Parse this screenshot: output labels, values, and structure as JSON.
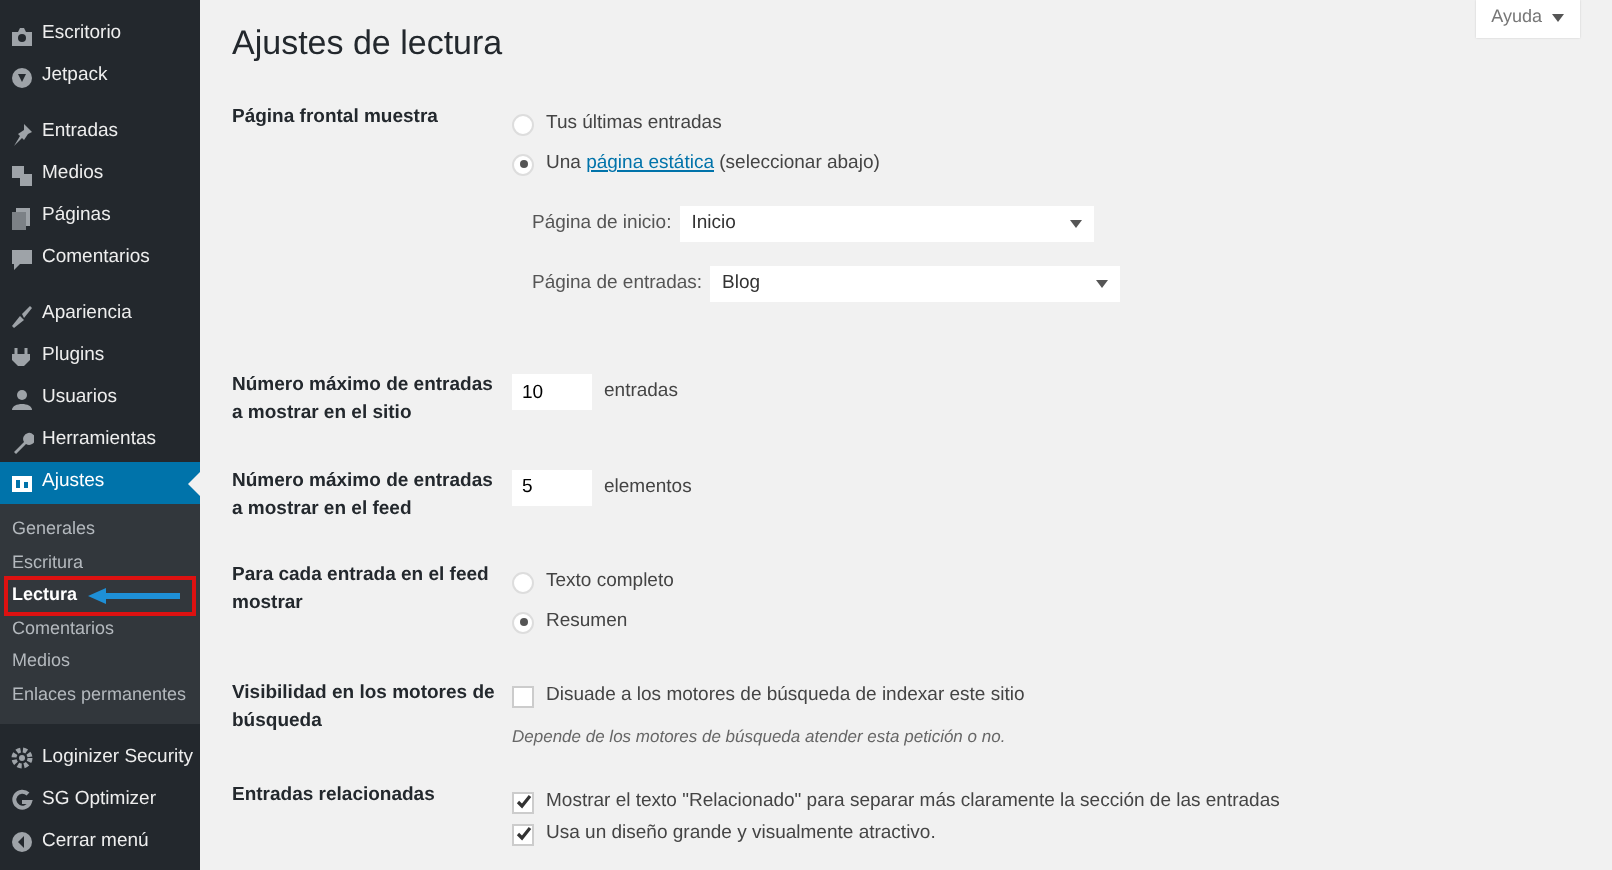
{
  "sidebar": {
    "groups": [
      [
        {
          "label": "Escritorio",
          "selected": false
        },
        {
          "label": "Jetpack",
          "selected": false
        }
      ],
      [
        {
          "label": "Entradas",
          "selected": false
        },
        {
          "label": "Medios",
          "selected": false
        },
        {
          "label": "Páginas",
          "selected": false
        },
        {
          "label": "Comentarios",
          "selected": false
        }
      ],
      [
        {
          "label": "Apariencia",
          "selected": false
        },
        {
          "label": "Plugins",
          "selected": false
        },
        {
          "label": "Usuarios",
          "selected": false
        },
        {
          "label": "Herramientas",
          "selected": false
        },
        {
          "label": "Ajustes",
          "selected": true,
          "submenu": [
            {
              "label": "Generales",
              "selected": false,
              "annotated": false
            },
            {
              "label": "Escritura",
              "selected": false,
              "annotated": false
            },
            {
              "label": "Lectura",
              "selected": true,
              "annotated": true
            },
            {
              "label": "Comentarios",
              "selected": false,
              "annotated": false
            },
            {
              "label": "Medios",
              "selected": false,
              "annotated": false
            },
            {
              "label": "Enlaces permanentes",
              "selected": false,
              "annotated": false
            }
          ]
        }
      ],
      [
        {
          "label": "Loginizer Security",
          "selected": false
        },
        {
          "label": "SG Optimizer",
          "selected": false
        },
        {
          "label": "Cerrar menú",
          "selected": false
        }
      ]
    ]
  },
  "help_button": {
    "label": "Ayuda"
  },
  "title": "Ajustes de lectura",
  "settings": [
    {
      "kind": "front",
      "label": "Página frontal muestra",
      "options": [
        {
          "label": "Tus últimas entradas",
          "selected": false
        },
        {
          "prefix": "Una",
          "link": "página estática",
          "suffix": "(seleccionar abajo)",
          "selected": true
        }
      ],
      "selects": [
        {
          "label": "Página de inicio:",
          "value": "Inicio"
        },
        {
          "label": "Página de entradas:",
          "value": "Blog"
        }
      ]
    },
    {
      "kind": "number",
      "label": "Número máximo de entradas a mostrar en el sitio",
      "value": "10",
      "unit": "entradas"
    },
    {
      "kind": "number",
      "label": "Número máximo de entradas a mostrar en el feed",
      "value": "5",
      "unit": "elementos"
    },
    {
      "kind": "radio",
      "label": "Para cada entrada en el feed mostrar",
      "options": [
        {
          "label": "Texto completo",
          "selected": false
        },
        {
          "label": "Resumen",
          "selected": true
        }
      ]
    },
    {
      "kind": "checkbox",
      "label": "Visibilidad en los motores de búsqueda",
      "options": [
        {
          "label": "Disuade a los motores de búsqueda de indexar este sitio",
          "checked": false
        }
      ],
      "description": "Depende de los motores de búsqueda atender esta petición o no."
    },
    {
      "kind": "checkbox",
      "label": "Entradas relacionadas",
      "options": [
        {
          "label": "Mostrar el texto \"Relacionado\" para separar más claramente la sección de las entradas",
          "checked": true
        },
        {
          "label": "Usa un diseño grande y visualmente atractivo.",
          "checked": true
        }
      ]
    }
  ]
}
